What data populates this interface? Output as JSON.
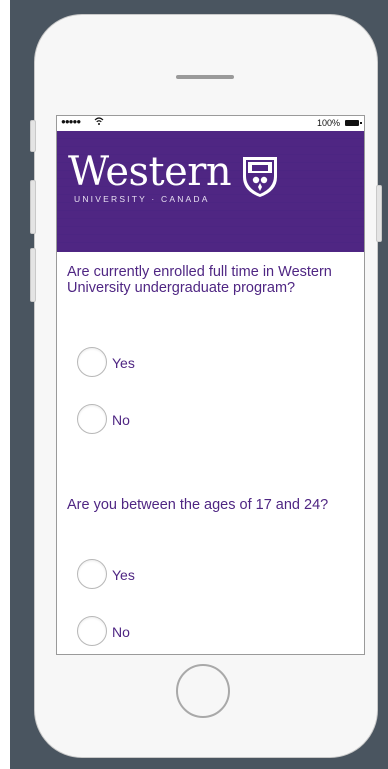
{
  "status_bar": {
    "signal": "●●●●●",
    "battery_percent": "100%"
  },
  "header": {
    "logo_text": "Western",
    "tagline": "UNIVERSITY · CANADA",
    "brand_color": "#4f2683"
  },
  "questions": [
    {
      "text": "Are currently enrolled full time in Western University undergraduate program?",
      "options": [
        "Yes",
        "No"
      ]
    },
    {
      "text": "Are you between the ages of 17 and 24?",
      "options": [
        "Yes",
        "No"
      ]
    }
  ]
}
